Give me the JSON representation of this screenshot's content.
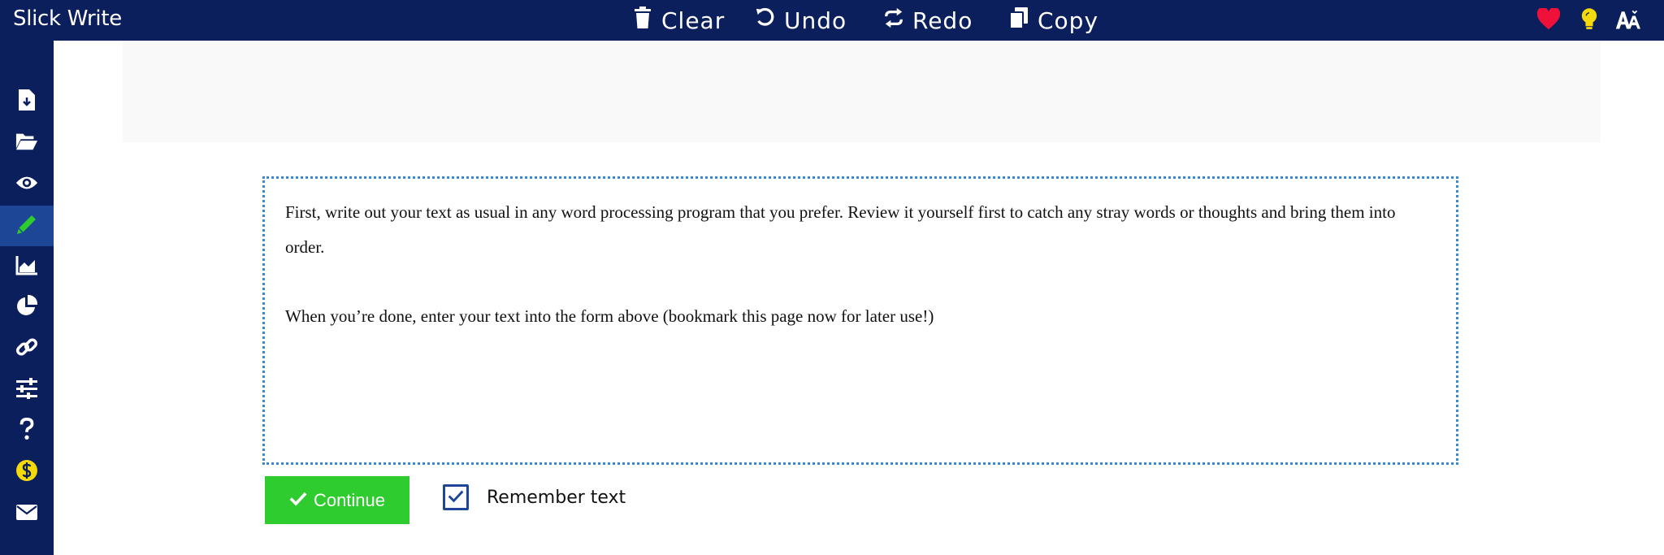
{
  "app": {
    "title": "Slick Write"
  },
  "toolbar": {
    "clear_label": "Clear",
    "undo_label": "Undo",
    "redo_label": "Redo",
    "copy_label": "Copy",
    "icons": [
      "trash-icon",
      "undo-icon",
      "redo-icon",
      "copy-icon"
    ]
  },
  "top_right": {
    "icons": [
      "heart-icon",
      "lightbulb-icon",
      "font-size-icon"
    ],
    "colors": {
      "heart": "#f0113a",
      "lightbulb": "#f5d90a",
      "font": "#ffffff"
    }
  },
  "sidebar": {
    "items": [
      {
        "icon": "save-file-icon"
      },
      {
        "icon": "open-folder-icon"
      },
      {
        "icon": "eye-icon"
      },
      {
        "icon": "pencil-icon",
        "active": true
      },
      {
        "icon": "area-chart-icon"
      },
      {
        "icon": "pie-chart-icon"
      },
      {
        "icon": "link-icon"
      },
      {
        "icon": "sliders-icon"
      },
      {
        "icon": "question-icon"
      },
      {
        "icon": "dollar-icon"
      },
      {
        "icon": "envelope-icon"
      }
    ]
  },
  "editor": {
    "paragraph_1": "First, write out your text as usual in any word processing program that you prefer. Review it yourself first to catch any stray words or thoughts and bring them into order.",
    "paragraph_2": "When you’re done, enter your text into the form above (bookmark this page now for later use!)"
  },
  "actions": {
    "continue_label": "Continue",
    "remember_label": "Remember text",
    "remember_checked": true
  },
  "colors": {
    "navbar": "#0b1f5c",
    "active_sidebar": "#1d4696",
    "continue_button": "#2ecc2e",
    "editor_border": "#3b8ad1"
  }
}
